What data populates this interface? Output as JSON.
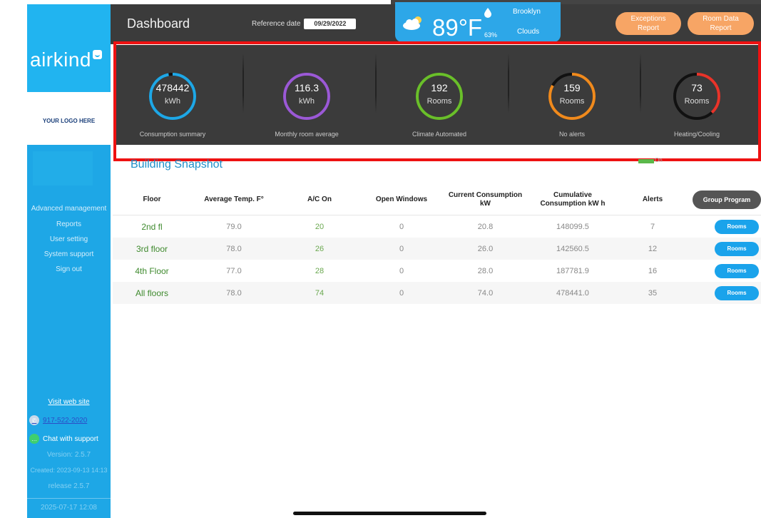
{
  "colors": {
    "sidebar": "#1ea7e6",
    "header": "#3b3b3b",
    "accent_orange": "#f7a565",
    "highlight": "#ee1111",
    "rooms_button": "#1aa3eb"
  },
  "sidebar": {
    "brand": "airkind",
    "logo_placeholder": "YOUR LOGO HERE",
    "items": [
      {
        "label": "Advanced management"
      },
      {
        "label": "Reports"
      },
      {
        "label": "User setting"
      },
      {
        "label": "System support"
      },
      {
        "label": "Sign out"
      }
    ],
    "visit_link": "Visit web site",
    "phone": "917-522-2020",
    "chat": "Chat with support",
    "version": "Version: 2.5.7",
    "created": "Created: 2023-09-13 14:13",
    "release": "release 2.5.7",
    "timestamp": "2025-07-17 12:08"
  },
  "header": {
    "title": "Dashboard",
    "ref_date_label": "Reference date",
    "ref_date_value": "09/29/2022",
    "weather": {
      "temp": "89°F",
      "humidity": "63%",
      "city": "Brooklyn",
      "condition": "Clouds",
      "icon": "cloud-sun-icon"
    },
    "exceptions_btn": [
      "Exceptions",
      "Report"
    ],
    "room_data_btn": [
      "Room Data",
      "Report"
    ]
  },
  "kpis": [
    {
      "value": "478442",
      "unit": "kWh",
      "label": "Consumption summary",
      "color": "#1ea7e6",
      "fraction": 0.97
    },
    {
      "value": "116.3",
      "unit": "kWh",
      "label": "Monthly room average",
      "color": "#9b59d6",
      "fraction": 1.0
    },
    {
      "value": "192",
      "unit": "Rooms",
      "label": "Climate Automated",
      "color": "#6abf2a",
      "fraction": 1.0
    },
    {
      "value": "159",
      "unit": "Rooms",
      "label": "No alerts",
      "color": "#f08a1d",
      "fraction": 0.83
    },
    {
      "value": "73",
      "unit": "Rooms",
      "label": "Heating/Cooling",
      "color": "#e8342a",
      "fraction": 0.38
    }
  ],
  "snapshot": {
    "title": "Building Snapshot",
    "legend": "On"
  },
  "table": {
    "columns": [
      "Floor",
      "Average Temp. F°",
      "A/C On",
      "Open Windows",
      [
        "Current Consumption",
        "kW"
      ],
      [
        "Cumulative",
        "Consumption kW h"
      ],
      "Alerts"
    ],
    "group_program": "Group Program",
    "rooms_label": "Rooms",
    "rows": [
      {
        "floor": "2nd fl",
        "avg": "79.0",
        "ac": "20",
        "windows": "0",
        "current": "20.8",
        "cumulative": "148099.5",
        "alerts": "7"
      },
      {
        "floor": "3rd floor",
        "avg": "78.0",
        "ac": "26",
        "windows": "0",
        "current": "26.0",
        "cumulative": "142560.5",
        "alerts": "12"
      },
      {
        "floor": "4th Floor",
        "avg": "77.0",
        "ac": "28",
        "windows": "0",
        "current": "28.0",
        "cumulative": "187781.9",
        "alerts": "16"
      },
      {
        "floor": "All floors",
        "avg": "78.0",
        "ac": "74",
        "windows": "0",
        "current": "74.0",
        "cumulative": "478441.0",
        "alerts": "35"
      }
    ]
  }
}
